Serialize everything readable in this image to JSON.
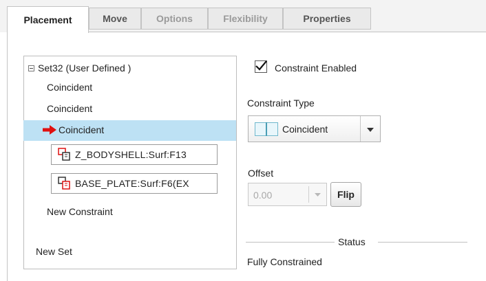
{
  "tabs": [
    {
      "label": "Placement"
    },
    {
      "label": "Move"
    },
    {
      "label": "Options"
    },
    {
      "label": "Flexibility"
    },
    {
      "label": "Properties"
    }
  ],
  "tree": {
    "set_label": "Set32 (User Defined )",
    "constraints": [
      "Coincident",
      "Coincident",
      "Coincident"
    ],
    "references": [
      "Z_BODYSHELL:Surf:F13",
      "BASE_PLATE:Surf:F6(EX"
    ],
    "new_constraint": "New Constraint",
    "new_set": "New Set"
  },
  "right": {
    "constraint_enabled_label": "Constraint Enabled",
    "constraint_enabled": true,
    "constraint_type_label": "Constraint Type",
    "constraint_type_value": "Coincident",
    "offset_label": "Offset",
    "offset_value": "0.00",
    "flip_label": "Flip",
    "status_label": "Status",
    "status_value": "Fully Constrained"
  },
  "colors": {
    "selection": "#bde1f4",
    "arrow": "#e01010",
    "coincident_icon": "#6fb7cc"
  }
}
